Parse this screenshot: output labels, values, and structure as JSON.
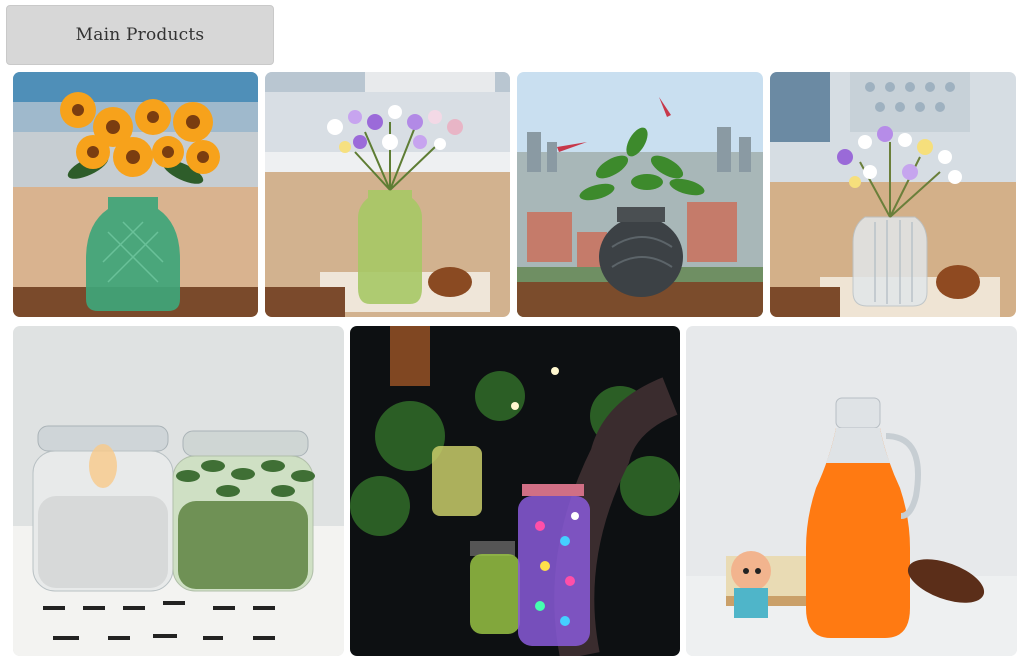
{
  "header": {
    "title": "Main Products"
  },
  "products": [
    {
      "icon": "green-glass-vase-sunflowers-image"
    },
    {
      "icon": "frosted-green-vase-wildflowers-image"
    },
    {
      "icon": "smoky-glass-vase-city-view-image"
    },
    {
      "icon": "ribbed-clear-vase-wildflowers-image"
    },
    {
      "icon": "glass-candle-jars-image"
    },
    {
      "icon": "solar-lantern-jars-night-image"
    },
    {
      "icon": "juice-jug-with-handle-image"
    }
  ],
  "colors": {
    "header_bg": "#d7d7d7",
    "juice": "#ff7a12",
    "vase_green": "#3ea57a"
  }
}
